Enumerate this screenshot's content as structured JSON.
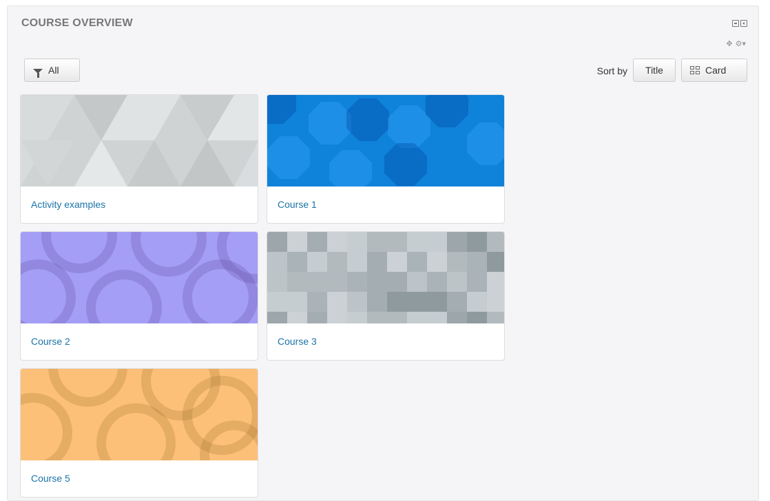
{
  "block": {
    "title": "COURSE OVERVIEW"
  },
  "toolbar": {
    "filter_label": "All",
    "sort_by_label": "Sort by",
    "sort_value": "Title",
    "view_value": "Card"
  },
  "courses": [
    {
      "name": "Activity examples",
      "pattern": "gray"
    },
    {
      "name": "Course 1",
      "pattern": "blue"
    },
    {
      "name": "Course 2",
      "pattern": "purple"
    },
    {
      "name": "Course 3",
      "pattern": "slate"
    },
    {
      "name": "Course 5",
      "pattern": "orange"
    }
  ],
  "icons": {
    "collapse": "collapse-icon",
    "dock": "dock-icon",
    "move": "move-icon",
    "settings": "gear-icon",
    "filter": "funnel-icon",
    "view": "grid-icon"
  },
  "colors": {
    "link": "#1a73a8",
    "panel_bg": "#f5f5f8",
    "gray_pattern": "#cfd3d4",
    "blue_pattern": "#0f82d9",
    "purple_pattern": "#a49ef7",
    "slate_pattern": "#b8c0c4",
    "orange_pattern": "#fdc078"
  }
}
